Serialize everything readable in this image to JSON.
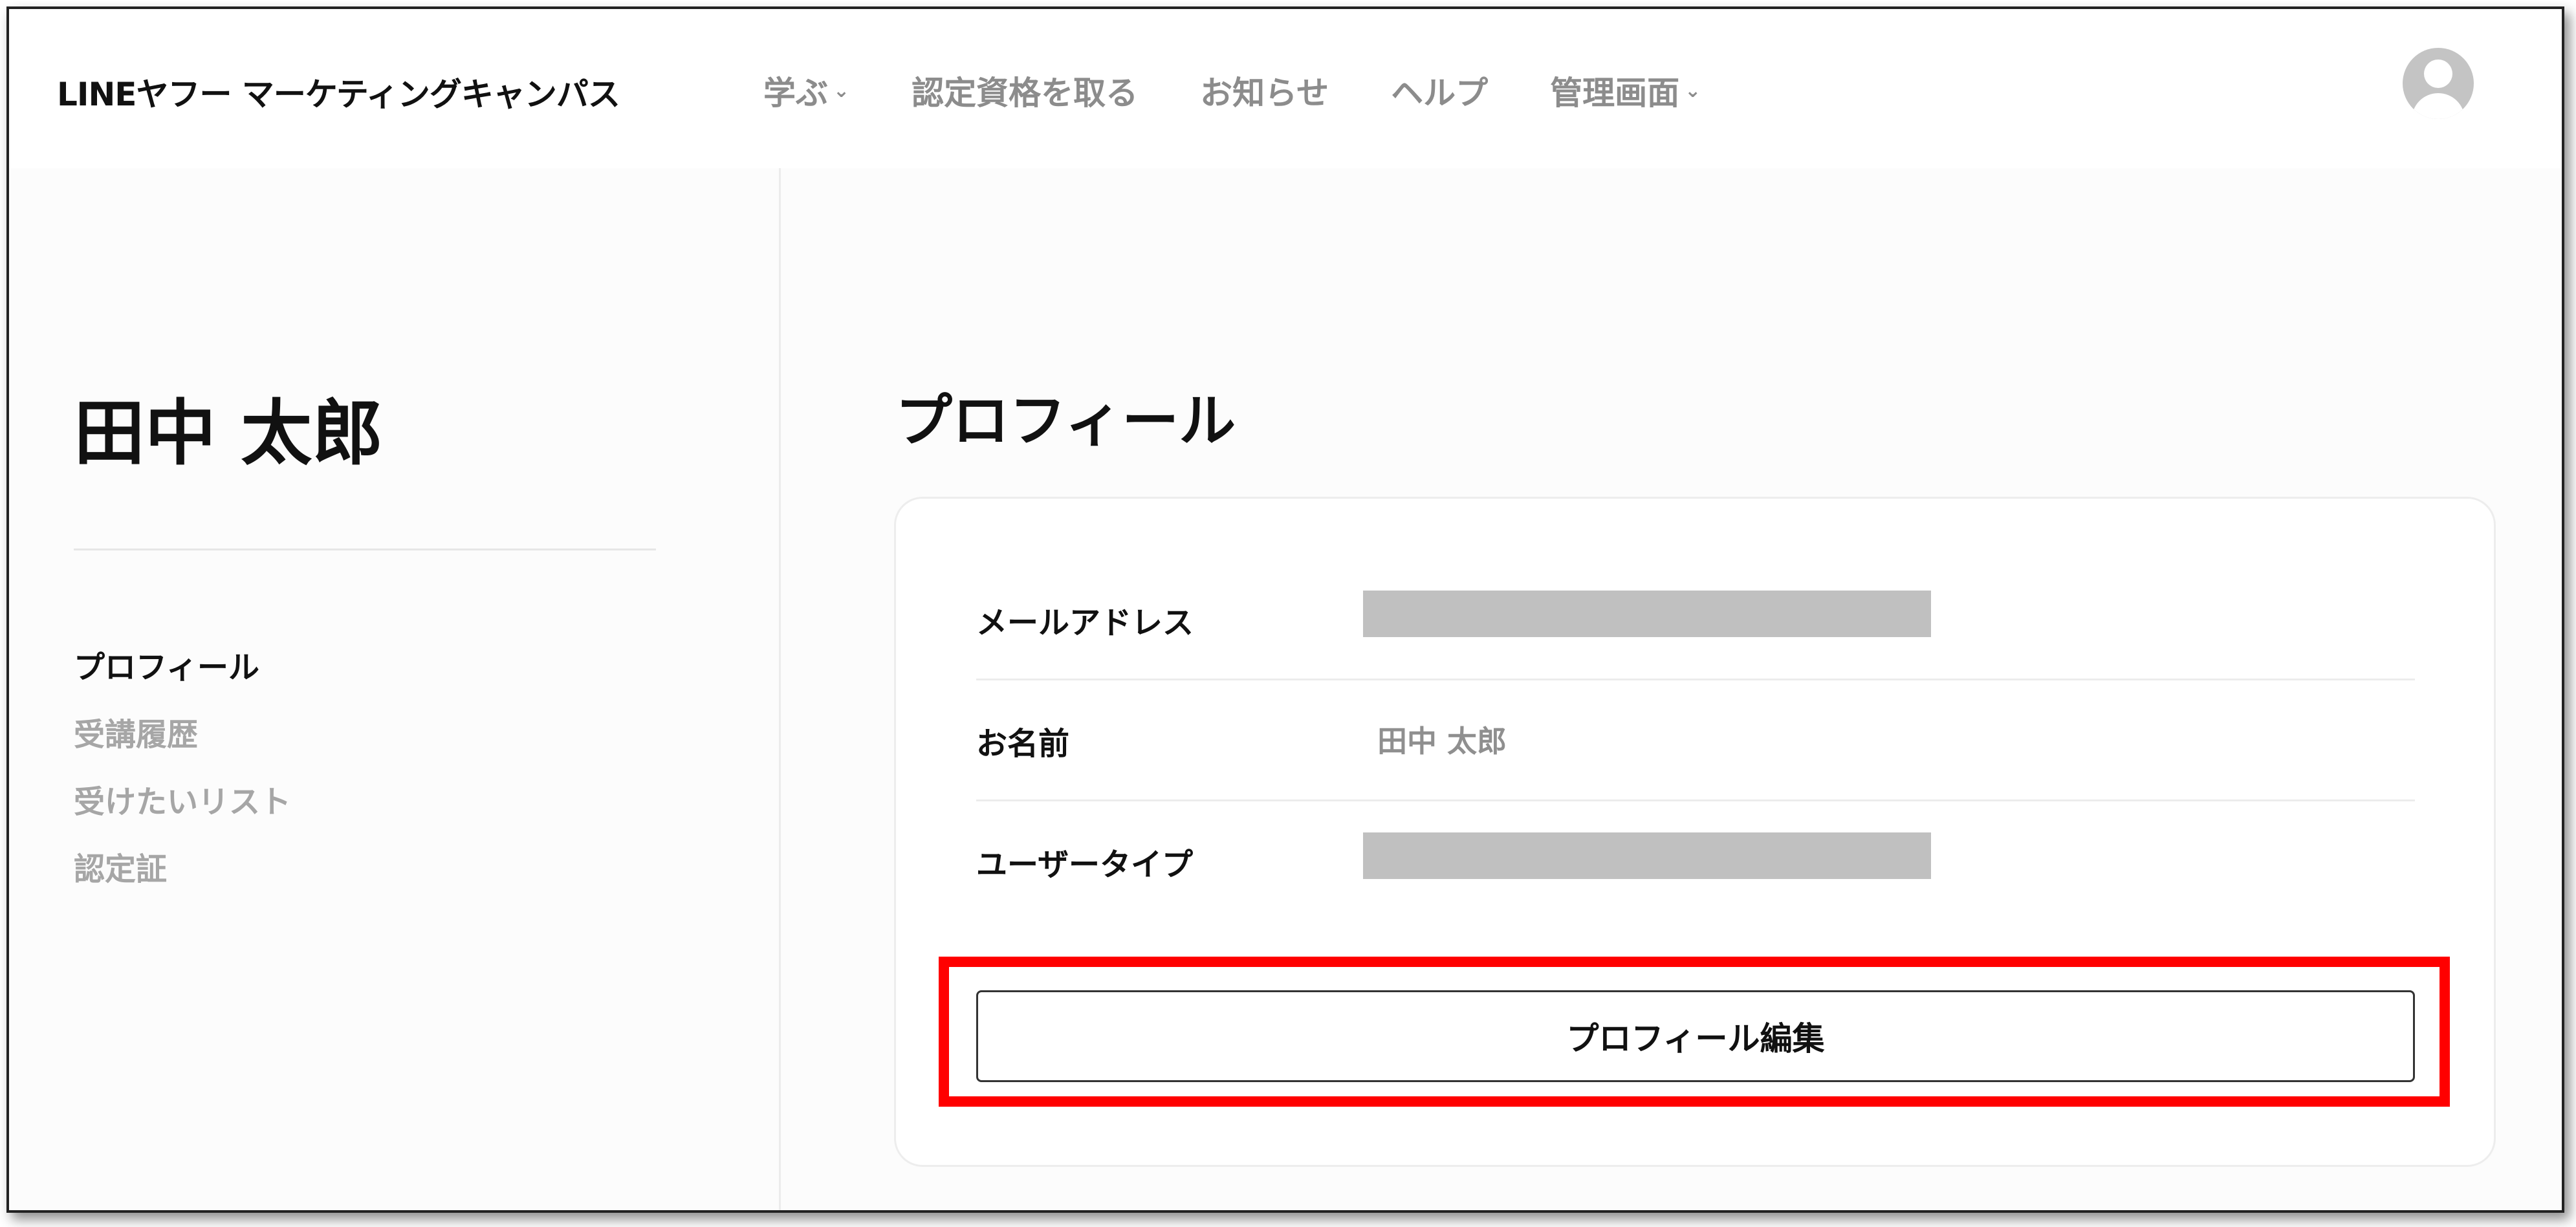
{
  "header": {
    "logo_text": "LINEヤフー マーケティングキャンパス",
    "nav": [
      {
        "label": "学ぶ",
        "has_dropdown": true
      },
      {
        "label": "認定資格を取る",
        "has_dropdown": false
      },
      {
        "label": "お知らせ",
        "has_dropdown": false
      },
      {
        "label": "ヘルプ",
        "has_dropdown": false
      },
      {
        "label": "管理画面",
        "has_dropdown": true
      }
    ],
    "dropdown_glyph": "⌄",
    "avatar_icon": "user-avatar-icon"
  },
  "sidebar": {
    "username": "田中 太郎",
    "items": [
      {
        "label": "プロフィール",
        "active": true
      },
      {
        "label": "受講履歴",
        "active": false
      },
      {
        "label": "受けたいリスト",
        "active": false
      },
      {
        "label": "認定証",
        "active": false
      }
    ]
  },
  "main": {
    "title": "プロフィール",
    "fields": [
      {
        "label": "メールアドレス",
        "value": null,
        "redacted": true
      },
      {
        "label": "お名前",
        "value": "田中 太郎",
        "redacted": false
      },
      {
        "label": "ユーザータイプ",
        "value": null,
        "redacted": true
      }
    ],
    "edit_button_label": "プロフィール編集"
  },
  "colors": {
    "highlight": "#ff0000",
    "text_primary": "#111111",
    "text_muted": "#8c8c8c",
    "redaction": "#c0c0c0"
  }
}
